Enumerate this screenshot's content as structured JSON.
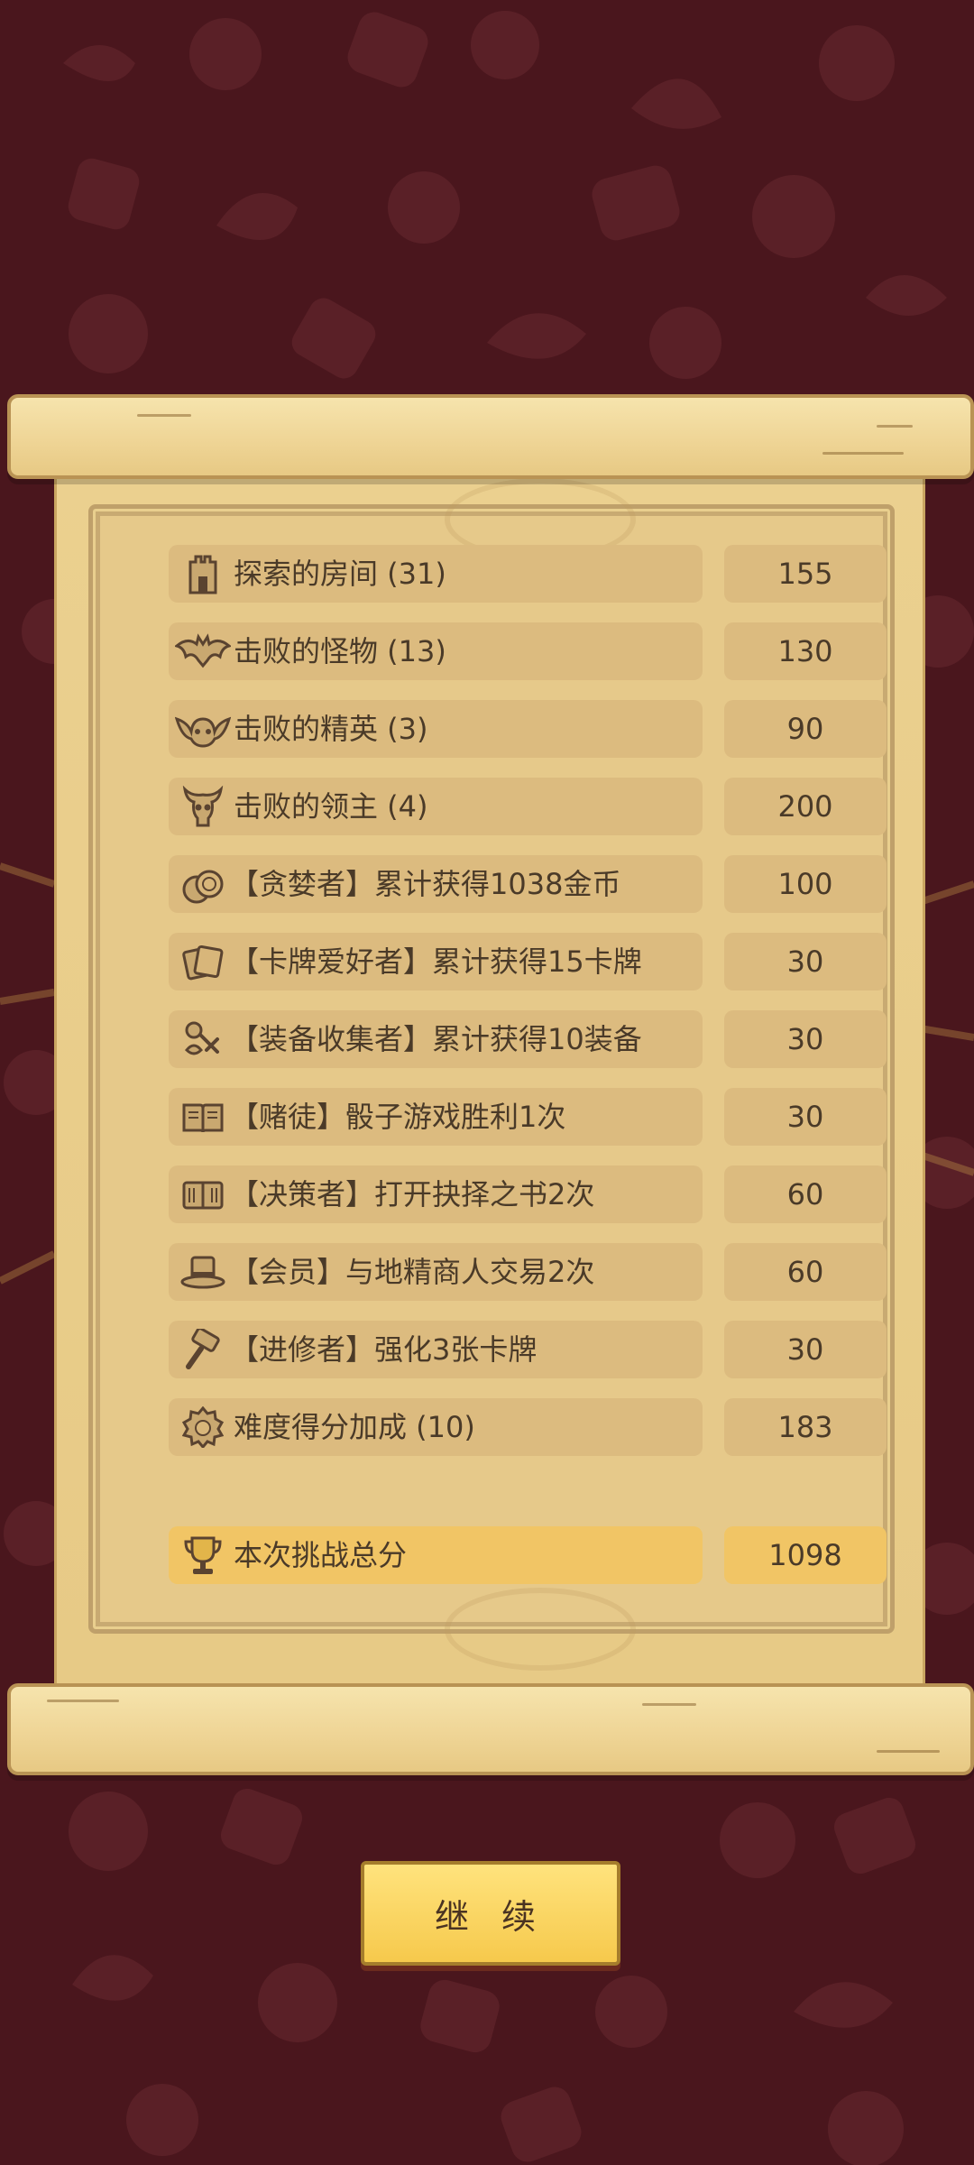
{
  "colors": {
    "background": "#4a161d",
    "parchment": "#ebd08f",
    "row_bg": "#dcbb7f",
    "total_row_bg": "#f1c565",
    "text": "#4a3a28",
    "button": "#f6c94c"
  },
  "score_rows": [
    {
      "icon": "tower-icon",
      "label": "探索的房间 (31)",
      "value": "155"
    },
    {
      "icon": "bat-icon",
      "label": "击败的怪物 (13)",
      "value": "130"
    },
    {
      "icon": "elite-demon-icon",
      "label": "击败的精英 (3)",
      "value": "90"
    },
    {
      "icon": "horned-skull-icon",
      "label": "击败的领主 (4)",
      "value": "200"
    },
    {
      "icon": "coin-stack-icon",
      "label": "【贪婪者】累计获得1038金币",
      "value": "100"
    },
    {
      "icon": "cards-icon",
      "label": "【卡牌爱好者】累计获得15卡牌",
      "value": "30"
    },
    {
      "icon": "equipment-icon",
      "label": "【装备收集者】累计获得10装备",
      "value": "30"
    },
    {
      "icon": "open-book-icon",
      "label": "【赌徒】骰子游戏胜利1次",
      "value": "30"
    },
    {
      "icon": "book-icon",
      "label": "【决策者】打开抉择之书2次",
      "value": "60"
    },
    {
      "icon": "top-hat-icon",
      "label": "【会员】与地精商人交易2次",
      "value": "60"
    },
    {
      "icon": "hammer-icon",
      "label": "【进修者】强化3张卡牌",
      "value": "30"
    },
    {
      "icon": "difficulty-badge-icon",
      "label": "难度得分加成 (10)",
      "value": "183"
    }
  ],
  "total": {
    "icon": "trophy-icon",
    "label": "本次挑战总分",
    "value": "1098"
  },
  "continue_label": "继 续"
}
